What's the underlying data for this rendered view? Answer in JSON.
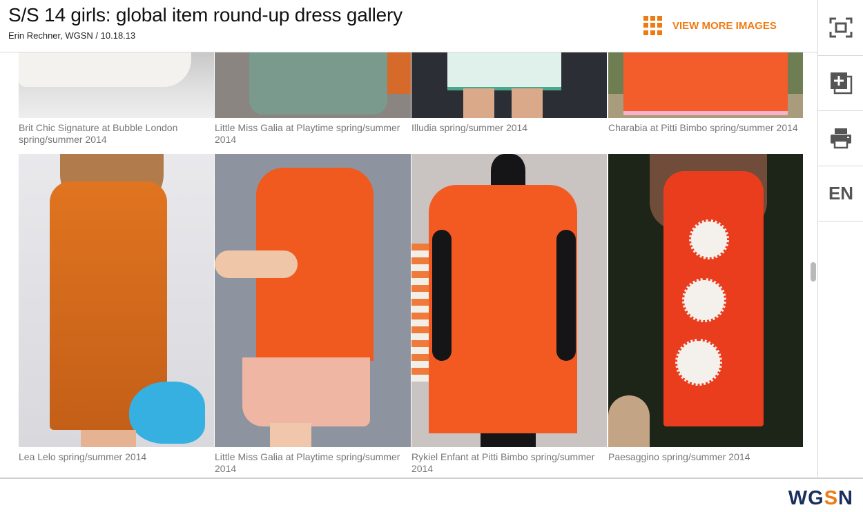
{
  "header": {
    "title": "S/S 14 girls: global item round-up dress gallery",
    "byline": "Erin Rechner, WGSN / 10.18.13",
    "view_more": "VIEW MORE IMAGES"
  },
  "sidebar": {
    "items": [
      {
        "icon": "fullscreen-icon"
      },
      {
        "icon": "add-to-board-icon"
      },
      {
        "icon": "print-icon"
      },
      {
        "label": "EN"
      }
    ]
  },
  "gallery": {
    "top_row": [
      {
        "caption": "Brit Chic Signature at Bubble London spring/summer 2014"
      },
      {
        "caption": "Little Miss Galia at Playtime spring/summer 2014"
      },
      {
        "caption": "Illudia spring/summer 2014"
      },
      {
        "caption": "Charabia at Pitti Bimbo spring/summer 2014"
      }
    ],
    "bottom_row": [
      {
        "caption": "Lea Lelo spring/summer 2014"
      },
      {
        "caption": "Little Miss Galia at Playtime spring/summer 2014"
      },
      {
        "caption": "Rykiel Enfant at Pitti Bimbo spring/summer 2014"
      },
      {
        "caption": "Paesaggino spring/summer 2014"
      }
    ]
  },
  "footer": {
    "logo_part1": "WG",
    "logo_part2": "S",
    "logo_part3": "N"
  },
  "colors": {
    "accent": "#f07a12",
    "logo_navy": "#1a2f5e"
  }
}
